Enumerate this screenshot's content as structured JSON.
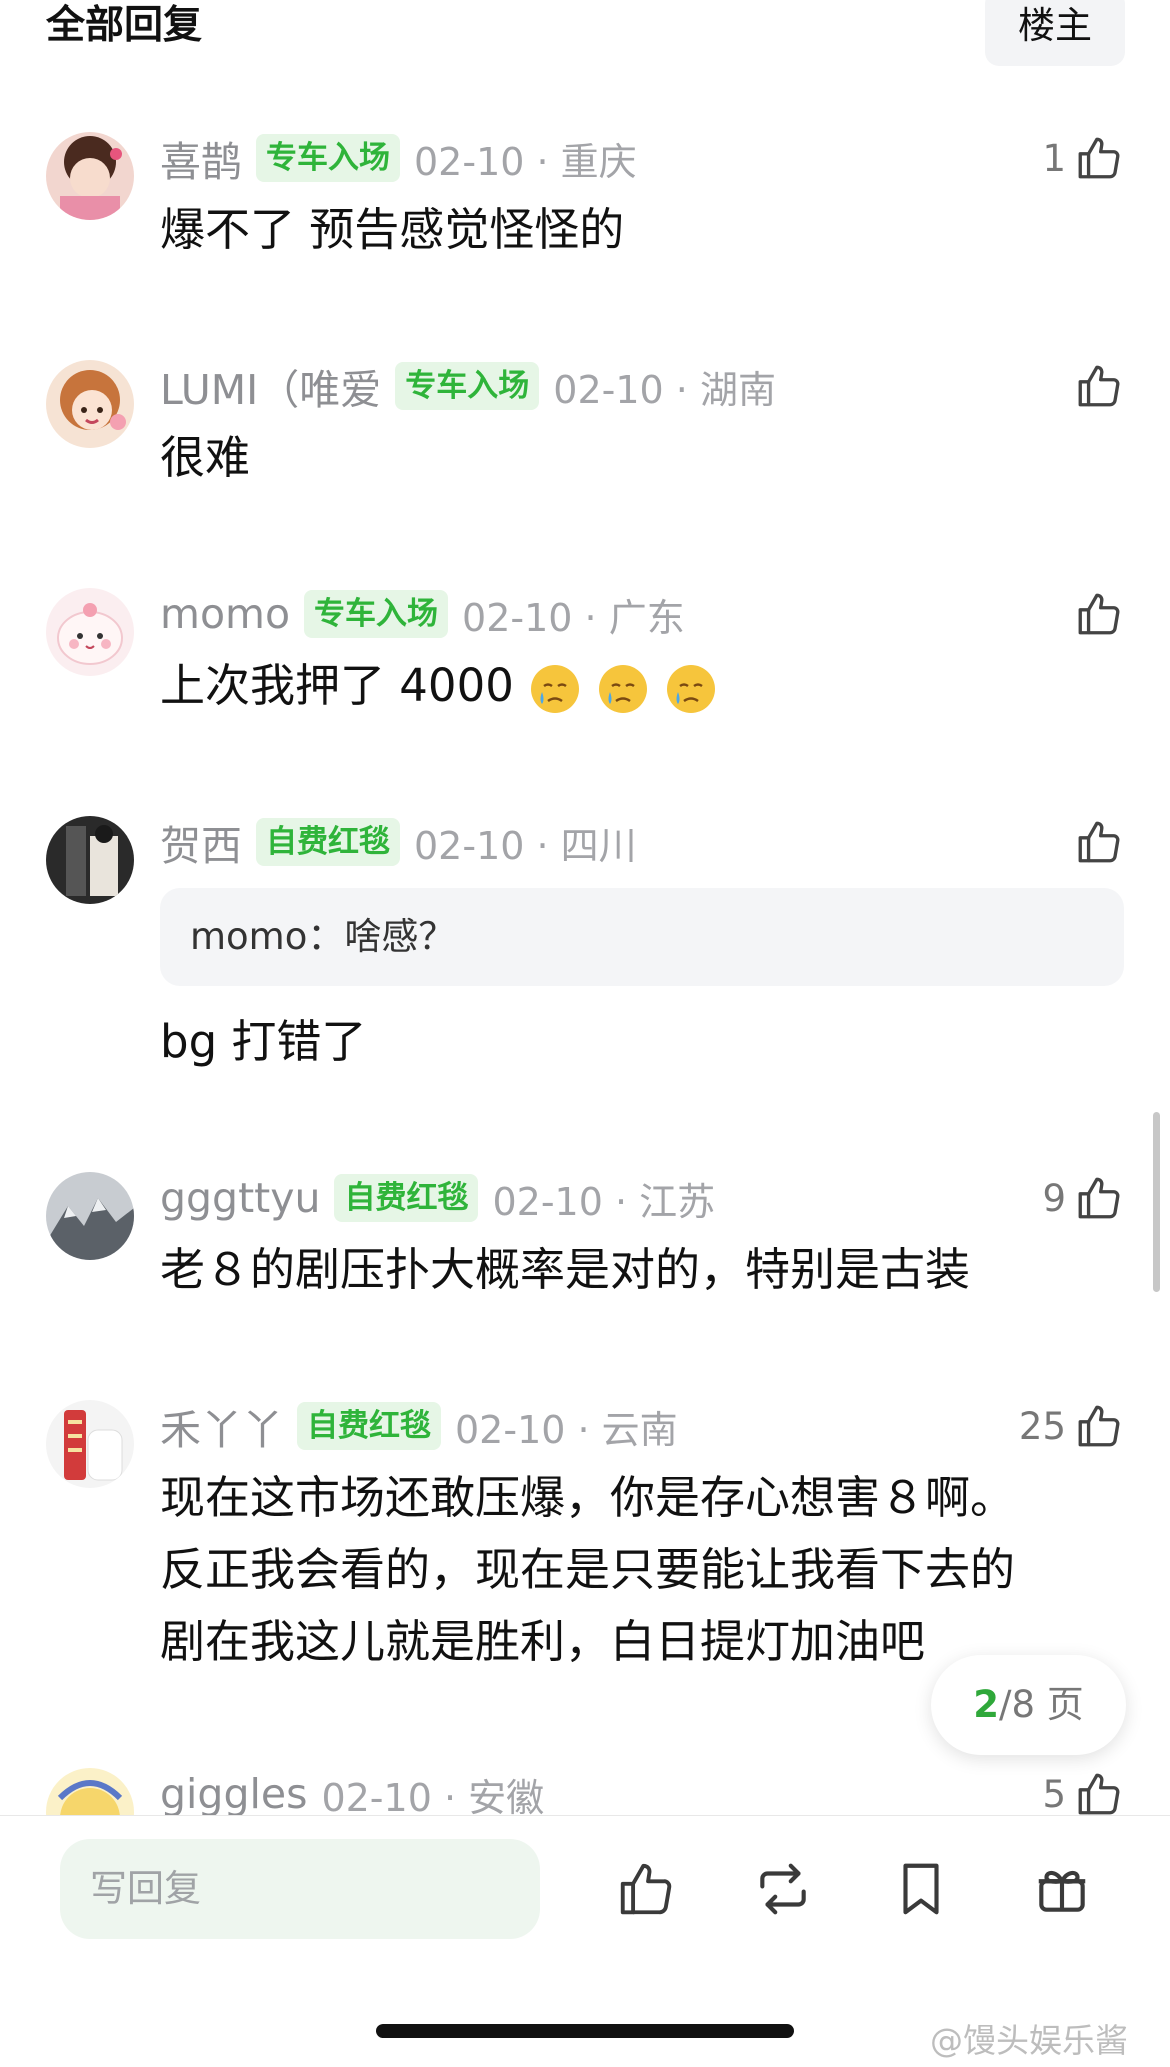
{
  "header": {
    "title": "全部回复",
    "owner_button": "楼主"
  },
  "comments": [
    {
      "username": "喜鹊",
      "badge": "专车入场",
      "meta": "02-10 · 重庆",
      "likes": "1",
      "text": "爆不了 预告感觉怪怪的"
    },
    {
      "username": "LUMI（唯爱",
      "badge": "专车入场",
      "meta": "02-10 · 湖南",
      "likes": "",
      "text": "很难"
    },
    {
      "username": "momo",
      "badge": "专车入场",
      "meta": "02-10 · 广东",
      "likes": "",
      "text": "上次我押了 4000",
      "emoji_name": "crying-face-emoji"
    },
    {
      "username": "贺西",
      "badge": "自费红毯",
      "meta": "02-10 · 四川",
      "likes": "",
      "quote_author": "momo：",
      "quote_text": "啥感？",
      "text": "bg 打错了"
    },
    {
      "username": "gggttyu",
      "badge": "自费红毯",
      "meta": "02-10 · 江苏",
      "likes": "9",
      "text": "老８的剧压扑大概率是对的，特别是古装"
    },
    {
      "username": "禾丫丫",
      "badge": "自费红毯",
      "meta": "02-10 · 云南",
      "likes": "25",
      "text_lines": [
        "现在这市场还敢压爆，你是存心想害８啊。",
        "反正我会看的，现在是只要能让我看下去的",
        "剧在我这儿就是胜利，白日提灯加油吧"
      ]
    },
    {
      "username": "giggles",
      "badge": "",
      "meta": "02-10 · 安徽",
      "likes": "5"
    }
  ],
  "pager": {
    "current": "2",
    "total": "/8 页"
  },
  "bottom_bar": {
    "reply_placeholder": "写回复",
    "icons": [
      "thumbs-up-icon",
      "repost-icon",
      "bookmark-icon",
      "gift-icon"
    ]
  },
  "watermark": "@馒头娱乐酱",
  "colors": {
    "badge_green": "#2fb43a",
    "badge_bg": "#e6f6e6",
    "pager_current": "#2fa83a",
    "input_bg": "#eef6ef"
  }
}
